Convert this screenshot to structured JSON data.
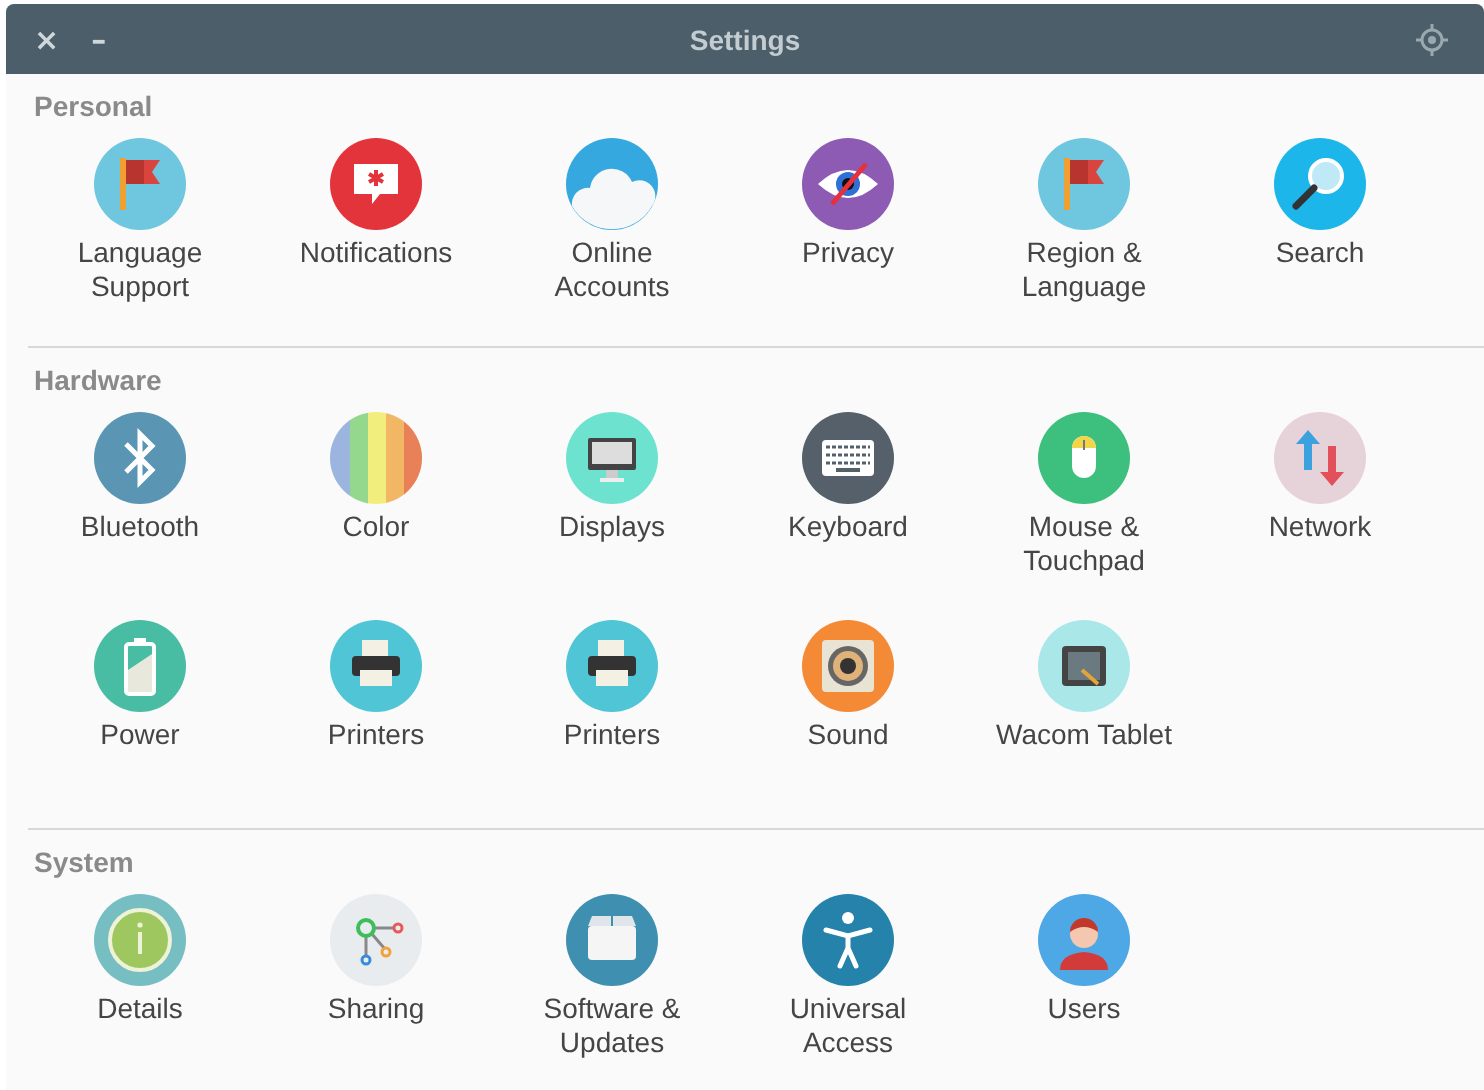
{
  "window": {
    "title": "Settings",
    "close_button": "×",
    "minimize_button": "–"
  },
  "sections": [
    {
      "title": "Personal",
      "items": [
        {
          "label": "Language Support"
        },
        {
          "label": "Notifications"
        },
        {
          "label": "Online Accounts"
        },
        {
          "label": "Privacy"
        },
        {
          "label": "Region & Language"
        },
        {
          "label": "Search"
        }
      ]
    },
    {
      "title": "Hardware",
      "items": [
        {
          "label": "Bluetooth"
        },
        {
          "label": "Color"
        },
        {
          "label": "Displays"
        },
        {
          "label": "Keyboard"
        },
        {
          "label": "Mouse & Touchpad"
        },
        {
          "label": "Network"
        },
        {
          "label": "Power"
        },
        {
          "label": "Printers"
        },
        {
          "label": "Printers"
        },
        {
          "label": "Sound"
        },
        {
          "label": "Wacom Tablet"
        }
      ]
    },
    {
      "title": "System",
      "items": [
        {
          "label": "Details"
        },
        {
          "label": "Sharing"
        },
        {
          "label": "Software & Updates"
        },
        {
          "label": "Universal Access"
        },
        {
          "label": "Users"
        }
      ]
    }
  ]
}
